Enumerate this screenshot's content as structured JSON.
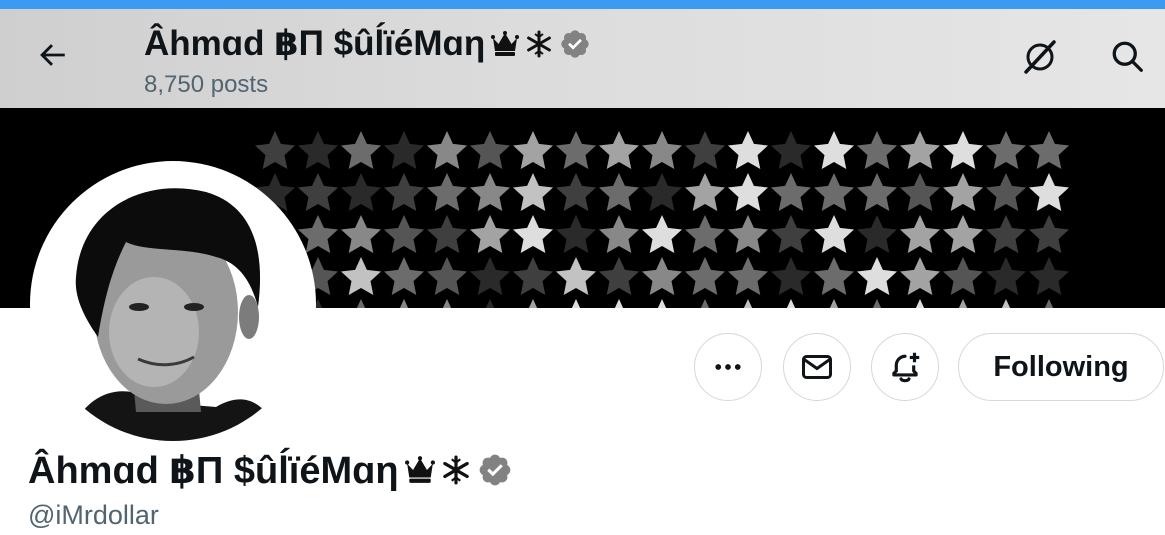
{
  "header": {
    "display_name": "Âhmɑd ฿Π $ûĺïéMɑη",
    "posts_count": "8,750",
    "posts_label": "posts",
    "icons": [
      "back-arrow-icon",
      "grok-icon",
      "search-icon"
    ]
  },
  "banner": {
    "pattern": "stars",
    "background": "#000000"
  },
  "actions": {
    "more_icon": "more-horizontal-icon",
    "message_icon": "envelope-icon",
    "notify_icon": "bell-plus-icon",
    "following_label": "Following"
  },
  "profile": {
    "display_name": "Âhmɑd ฿Π $ûĺïéMɑη",
    "badges": [
      "crown-icon",
      "snowflake-icon",
      "verified-badge-icon"
    ],
    "handle": "@iMrdollar"
  },
  "colors": {
    "accent_top": "#3b9bf2",
    "text_primary": "#0f1419",
    "text_secondary": "#536471",
    "border": "#cfd9de",
    "verified_gray": "#828282"
  }
}
